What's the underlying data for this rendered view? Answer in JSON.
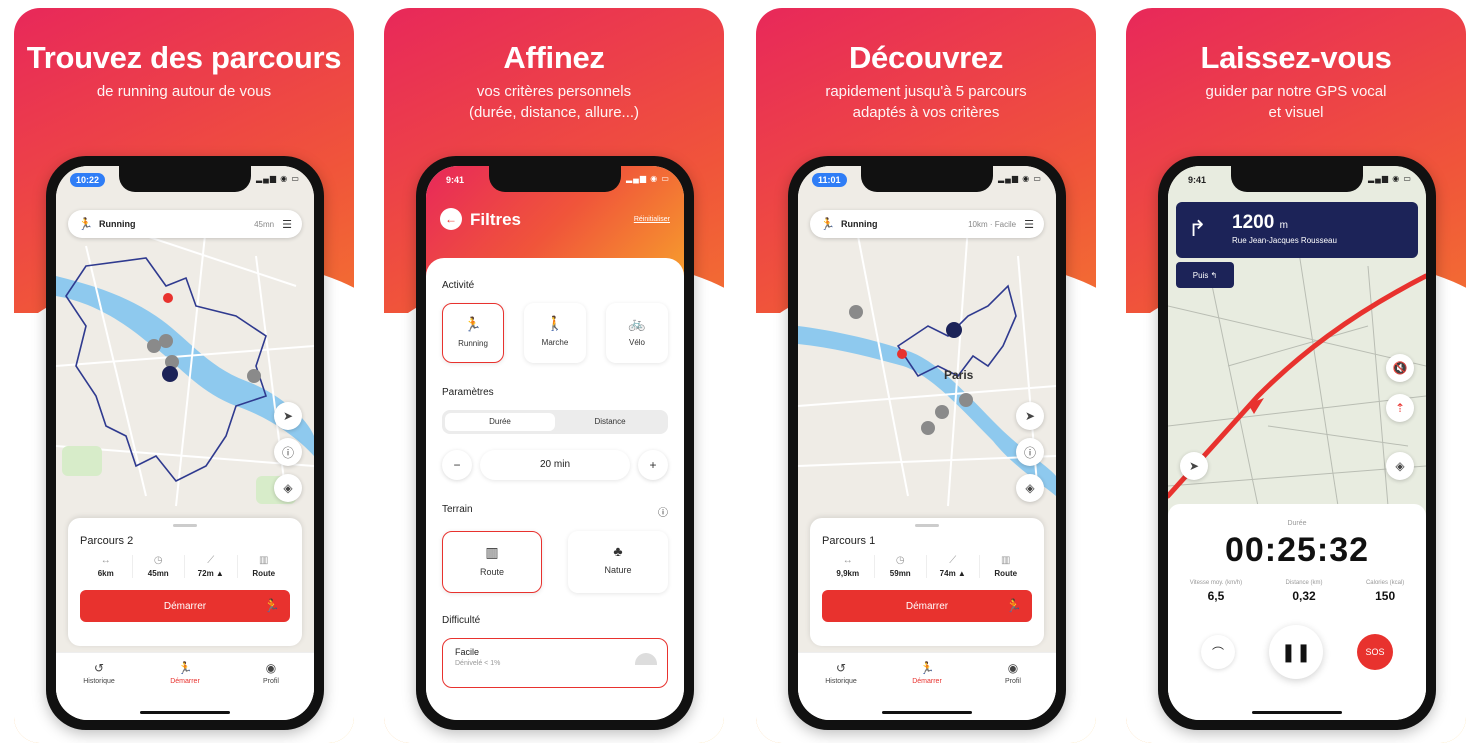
{
  "panels": [
    {
      "headline": "Trouvez des parcours",
      "sub1": "de running autour de vous",
      "sub2": ""
    },
    {
      "headline": "Affinez",
      "sub1": "vos critères personnels",
      "sub2": "(durée, distance, allure...)"
    },
    {
      "headline": "Découvrez",
      "sub1": "rapidement jusqu'à 5 parcours",
      "sub2": "adaptés à vos critères"
    },
    {
      "headline": "Laissez-vous",
      "sub1": "guider par notre GPS vocal",
      "sub2": "et visuel"
    }
  ],
  "screen1": {
    "time": "10:22",
    "search": {
      "label": "Running",
      "meta": "45mn"
    },
    "card": {
      "title": "Parcours 2",
      "stats": [
        {
          "icon": "↔",
          "value": "6km"
        },
        {
          "icon": "◷",
          "value": "45mn"
        },
        {
          "icon": "⟋",
          "value": "72m ▲"
        },
        {
          "icon": "▥",
          "value": "Route"
        }
      ],
      "start_label": "Démarrer"
    },
    "tabs": [
      "Historique",
      "Démarrer",
      "Profil"
    ]
  },
  "screen2": {
    "time": "9:41",
    "title": "Filtres",
    "reset": "Réinitialiser",
    "activity_title": "Activité",
    "activities": [
      "Running",
      "Marche",
      "Vélo"
    ],
    "params_title": "Paramètres",
    "segments": [
      "Durée",
      "Distance"
    ],
    "stepper_value": "20 min",
    "terrain_title": "Terrain",
    "terrains": [
      "Route",
      "Nature"
    ],
    "difficulty_title": "Difficulté",
    "difficulty": {
      "label": "Facile",
      "sub": "Dénivelé < 1%"
    }
  },
  "screen3": {
    "time": "11:01",
    "search": {
      "label": "Running",
      "meta": "10km · Facile"
    },
    "city_label": "Paris",
    "card": {
      "title": "Parcours 1",
      "stats": [
        {
          "icon": "↔",
          "value": "9,9km"
        },
        {
          "icon": "◷",
          "value": "59mn"
        },
        {
          "icon": "⟋",
          "value": "74m ▲"
        },
        {
          "icon": "▥",
          "value": "Route"
        }
      ],
      "start_label": "Démarrer"
    },
    "tabs": [
      "Historique",
      "Démarrer",
      "Profil"
    ]
  },
  "screen4": {
    "time": "9:41",
    "distance": "1200",
    "unit": "m",
    "street": "Rue Jean-Jacques Rousseau",
    "then": "Puis",
    "duration_label": "Durée",
    "timer": "00:25:32",
    "stats": [
      {
        "k": "Vitesse moy. (km/h)",
        "v": "6,5"
      },
      {
        "k": "Distance (km)",
        "v": "0,32"
      },
      {
        "k": "Calories (kcal)",
        "v": "150"
      }
    ],
    "sos": "SOS"
  },
  "colors": {
    "accent": "#e8322e",
    "nav_blue": "#1c2358",
    "route_blue": "#2f3a8f"
  }
}
